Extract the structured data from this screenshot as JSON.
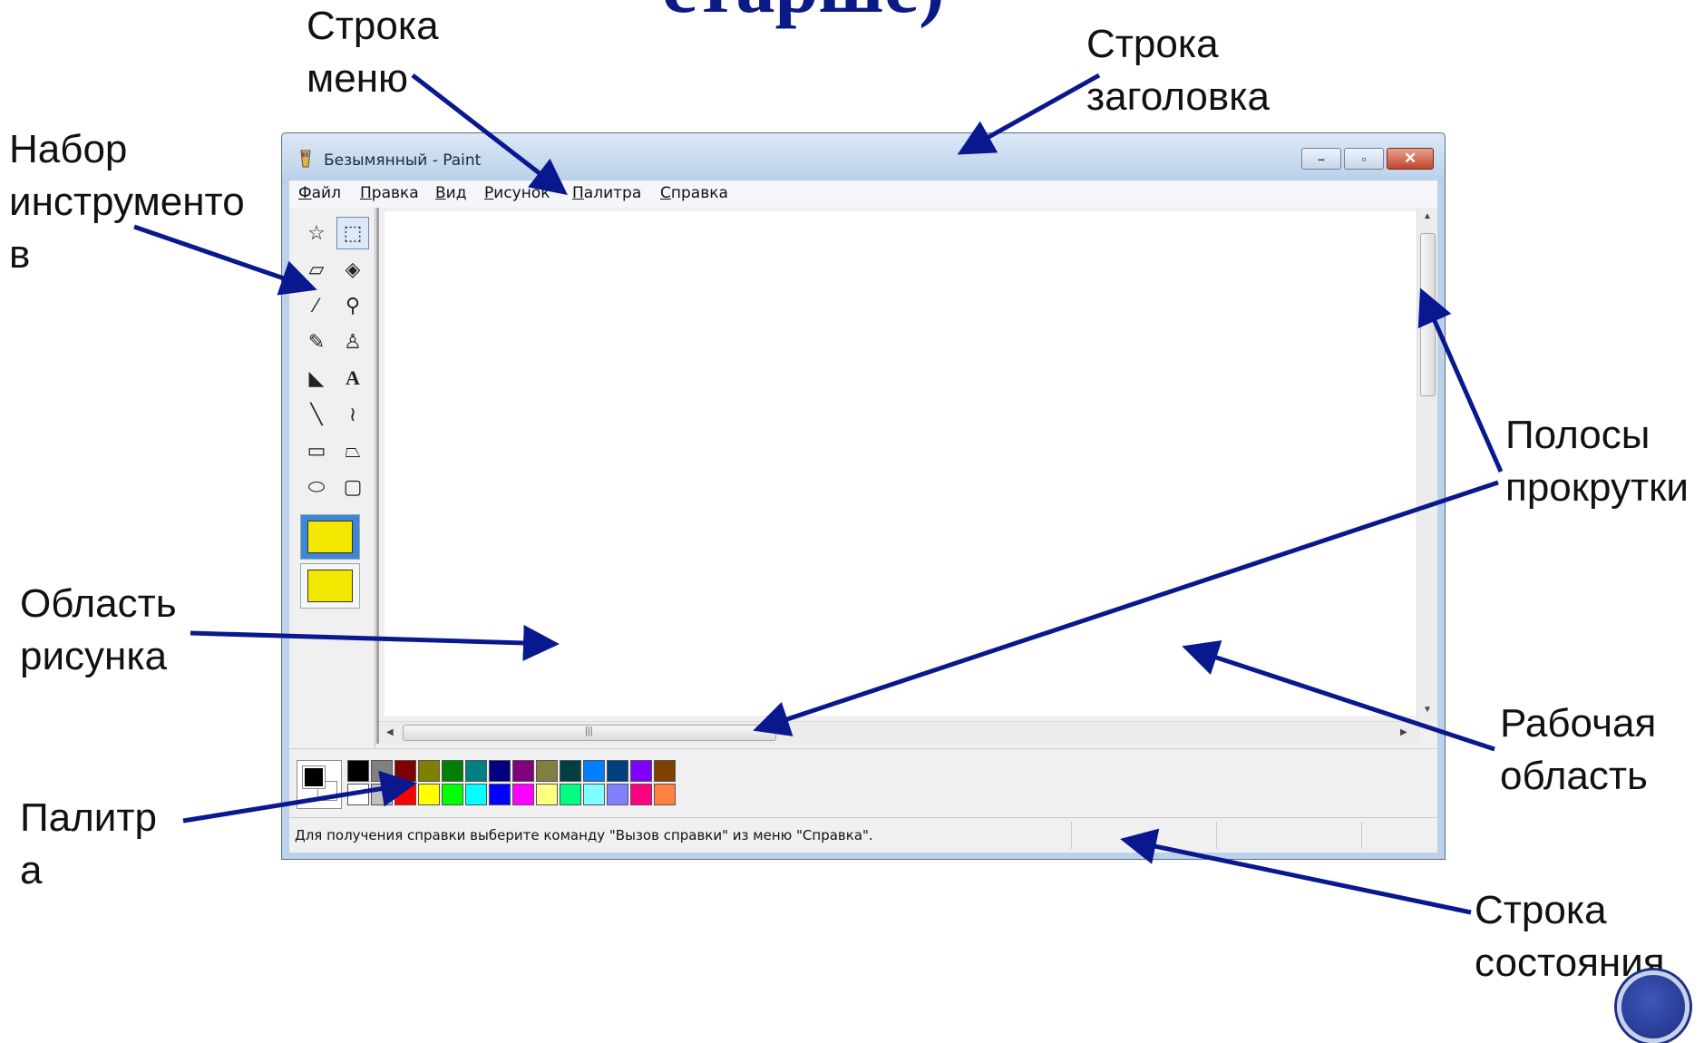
{
  "slide": {
    "title": "старше)",
    "callouts": {
      "menu_bar": "Строка\nменю",
      "title_bar": "Строка\nзаголовка",
      "toolbox": "Набор\nинструменто\nв",
      "scrollbars": "Полосы\nпрокрутки",
      "drawing_area": "Область\nрисунка",
      "work_area": "Рабочая\nобласть",
      "palette": "Палитр\nа",
      "status_bar": "Строка\nсостояния"
    },
    "arrow_color": "#0a1890"
  },
  "window": {
    "title": "Безымянный - Paint",
    "buttons": {
      "minimize": "–",
      "maximize": "▫",
      "close": "✕"
    }
  },
  "menu": [
    "Файл",
    "Правка",
    "Вид",
    "Рисунок",
    "Палитра",
    "Справка"
  ],
  "tools": [
    {
      "name": "free-select-icon",
      "glyph": "☆"
    },
    {
      "name": "rect-select-icon",
      "glyph": "⬚"
    },
    {
      "name": "eraser-icon",
      "glyph": "▱"
    },
    {
      "name": "fill-bucket-icon",
      "glyph": "◈"
    },
    {
      "name": "color-picker-icon",
      "glyph": "⁄"
    },
    {
      "name": "magnifier-icon",
      "glyph": "⚲"
    },
    {
      "name": "pencil-icon",
      "glyph": "✎"
    },
    {
      "name": "brush-icon",
      "glyph": "♙"
    },
    {
      "name": "airbrush-icon",
      "glyph": "◣"
    },
    {
      "name": "text-tool-icon",
      "glyph": "A"
    },
    {
      "name": "line-icon",
      "glyph": "╲"
    },
    {
      "name": "curve-icon",
      "glyph": "≀"
    },
    {
      "name": "rectangle-icon",
      "glyph": "▭"
    },
    {
      "name": "polygon-icon",
      "glyph": "⏢"
    },
    {
      "name": "ellipse-icon",
      "glyph": "⬭"
    },
    {
      "name": "rounded-rectangle-icon",
      "glyph": "▢"
    }
  ],
  "palette": {
    "row1": [
      "#000000",
      "#808080",
      "#800000",
      "#808000",
      "#008000",
      "#008080",
      "#000080",
      "#800080",
      "#808040",
      "#004040",
      "#0080ff",
      "#004080",
      "#8000ff",
      "#804000"
    ],
    "row2": [
      "#ffffff",
      "#c0c0c0",
      "#ff0000",
      "#ffff00",
      "#00ff00",
      "#00ffff",
      "#0000ff",
      "#ff00ff",
      "#ffff80",
      "#00ff80",
      "#80ffff",
      "#8080ff",
      "#ff0080",
      "#ff8040"
    ]
  },
  "status": {
    "text": "Для получения справки выберите команду \"Вызов справки\" из меню \"Справка\"."
  }
}
